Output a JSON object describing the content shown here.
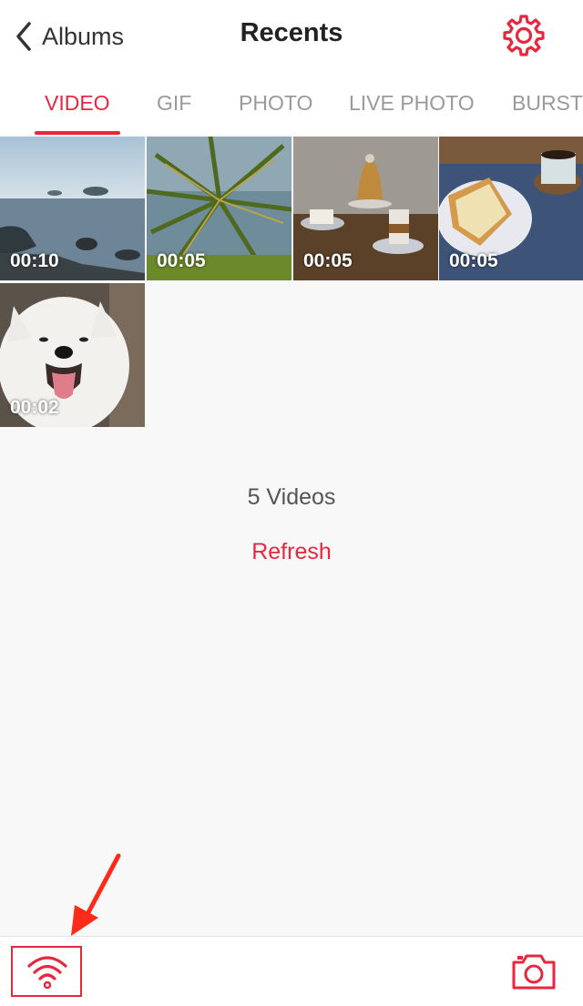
{
  "nav": {
    "back_label": "Albums",
    "title": "Recents",
    "back_icon": "chevron-left-icon",
    "settings_icon": "gear-icon"
  },
  "tabs": [
    {
      "label": "VIDEO",
      "active": true
    },
    {
      "label": "GIF",
      "active": false
    },
    {
      "label": "PHOTO",
      "active": false
    },
    {
      "label": "LIVE PHOTO",
      "active": false
    },
    {
      "label": "BURST",
      "active": false
    }
  ],
  "videos": [
    {
      "duration": "00:10",
      "subject": "sea-coast"
    },
    {
      "duration": "00:05",
      "subject": "palm-tree"
    },
    {
      "duration": "00:05",
      "subject": "cafe-dessert"
    },
    {
      "duration": "00:05",
      "subject": "toast-coffee"
    },
    {
      "duration": "00:02",
      "subject": "white-dog"
    }
  ],
  "summary": {
    "count_text": "5 Videos",
    "refresh_label": "Refresh"
  },
  "bottom_bar": {
    "wifi_icon": "wifi-icon",
    "camera_icon": "camera-icon"
  },
  "colors": {
    "accent": "#e8273f",
    "background": "#f8f8f8",
    "annotation": "#ff2a1a"
  }
}
